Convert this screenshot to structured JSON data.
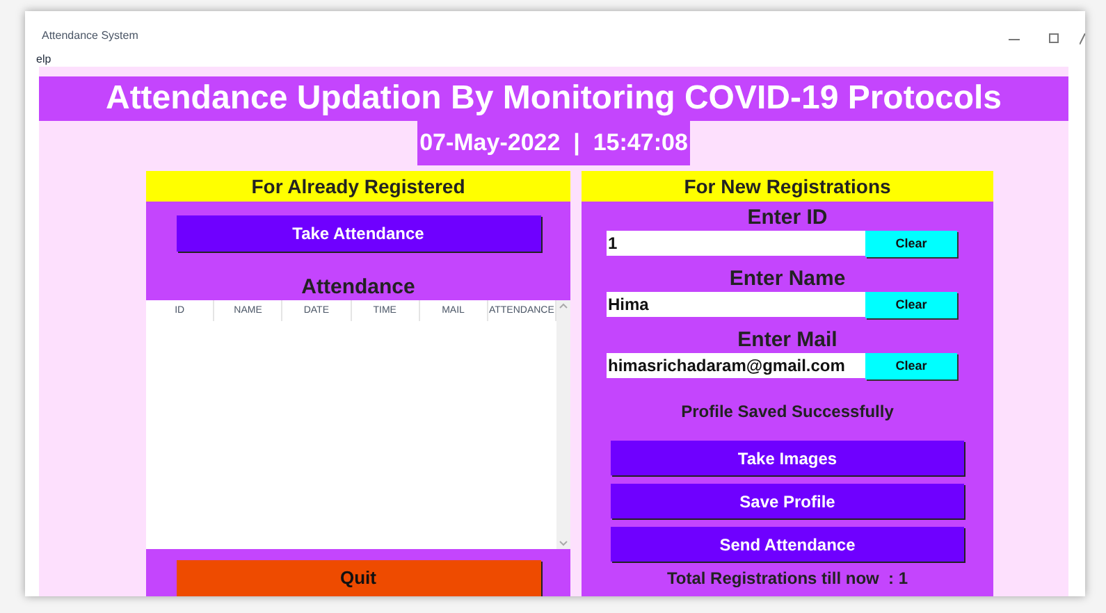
{
  "window": {
    "title": "Attendance System"
  },
  "menu": [
    "elp"
  ],
  "heading": "Attendance Updation By Monitoring COVID-19 Protocols",
  "datetime": "07-May-2022  |  15:47:08",
  "left_panel": {
    "header": "For Already Registered",
    "take_button": "Take Attendance",
    "table_title": "Attendance",
    "table": {
      "columns": [
        "ID",
        "NAME",
        "DATE",
        "TIME",
        "MAIL",
        "ATTENDANCE"
      ]
    },
    "quit_button": "Quit"
  },
  "right_panel": {
    "header": "For New Registrations",
    "fields": [
      {
        "label": "Enter ID",
        "value": "1",
        "clear_button": "Clear"
      },
      {
        "label": "Enter Name",
        "value": "Hima",
        "clear_button": "Clear"
      },
      {
        "label": "Enter Mail",
        "value": "himasrichadaram@gmail.com",
        "clear_button": "Clear"
      }
    ],
    "status": "Profile Saved Successfully",
    "buttons": [
      "Take Images",
      "Save Profile",
      "Send Attendance"
    ],
    "total": "Total Registrations till now  : 1"
  }
}
